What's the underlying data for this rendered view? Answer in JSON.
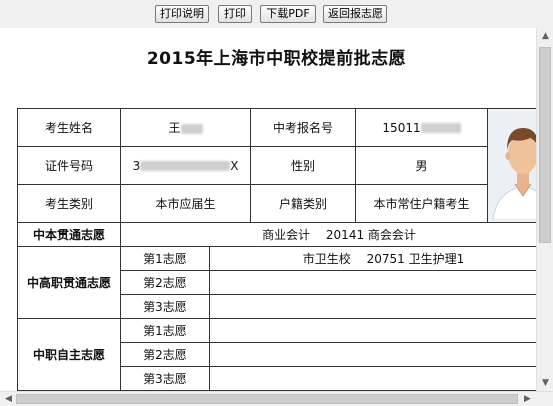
{
  "toolbar": {
    "buttons": [
      "打印说明",
      "打印",
      "下载PDF",
      "返回报志愿"
    ]
  },
  "page": {
    "title": "2015年上海市中职校提前批志愿"
  },
  "student": {
    "name_label": "考生姓名",
    "name_value_visible": "王",
    "exam_no_label": "中考报名号",
    "exam_no_value_visible": "15011",
    "id_label": "证件号码",
    "id_value_prefix": "3",
    "id_value_suffix": "X",
    "gender_label": "性别",
    "gender_value": "男",
    "category_label": "考生类别",
    "category_value": "本市应届生",
    "hukou_label": "户籍类别",
    "hukou_value": "本市常住户籍考生"
  },
  "photo": {
    "icon": "student-photo-placeholder"
  },
  "zhongben": {
    "label": "中本贯通志愿",
    "value": "商业会计　 20141  商会会计"
  },
  "zhonggao": {
    "label": "中高职贯通志愿",
    "choices": [
      {
        "label": "第1志愿",
        "value": "市卫生校　 20751  卫生护理1"
      },
      {
        "label": "第2志愿",
        "value": ""
      },
      {
        "label": "第3志愿",
        "value": ""
      }
    ]
  },
  "zhongzhi": {
    "label": "中职自主志愿",
    "choices": [
      {
        "label": "第1志愿",
        "value": ""
      },
      {
        "label": "第2志愿",
        "value": ""
      },
      {
        "label": "第3志愿",
        "value": ""
      }
    ]
  }
}
